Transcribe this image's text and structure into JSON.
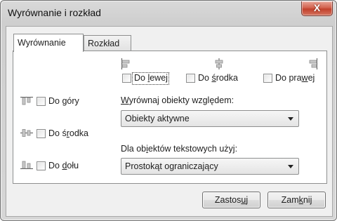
{
  "window": {
    "title": "Wyrównanie i rozkład",
    "close_glyph": "X"
  },
  "tabs": [
    {
      "label_pre": "Wyrównanie",
      "label_u": "",
      "label_post": "",
      "active": true
    },
    {
      "label_pre": "Rozkład",
      "label_u": "",
      "label_post": "",
      "active": false
    }
  ],
  "horizontal": {
    "left": {
      "pre": "Do ",
      "u": "l",
      "post": "ewej",
      "checked": false
    },
    "center": {
      "pre": "Do ",
      "u": "ś",
      "post": "rodka",
      "checked": false
    },
    "right": {
      "pre": "Do pra",
      "u": "w",
      "post": "ej",
      "checked": false
    }
  },
  "vertical": {
    "top": {
      "pre": "Do ",
      "u": "g",
      "post": "óry",
      "checked": false
    },
    "middle": {
      "pre": "Do ś",
      "u": "r",
      "post": "odka",
      "checked": false
    },
    "bottom": {
      "pre": "Do ",
      "u": "d",
      "post": "ołu",
      "checked": false
    }
  },
  "align_relative": {
    "label_pre": "",
    "label_u": "W",
    "label_post": "yrównaj obiekty względem:",
    "selected": "Obiekty aktywne"
  },
  "text_objects": {
    "label_pre": "Dla ob",
    "label_u": "i",
    "label_post": "ektów tekstowych użyj:",
    "selected": "Prostokąt ograniczający"
  },
  "buttons": {
    "apply": {
      "pre": "Zastos",
      "u": "u",
      "post": "j"
    },
    "close": {
      "pre": "Zam",
      "u": "k",
      "post": "nij"
    }
  },
  "icons": {
    "h_left": "align-left-icon",
    "h_center": "align-center-icon",
    "h_right": "align-right-icon",
    "v_top": "align-top-icon",
    "v_middle": "align-middle-icon",
    "v_bottom": "align-bottom-icon"
  }
}
